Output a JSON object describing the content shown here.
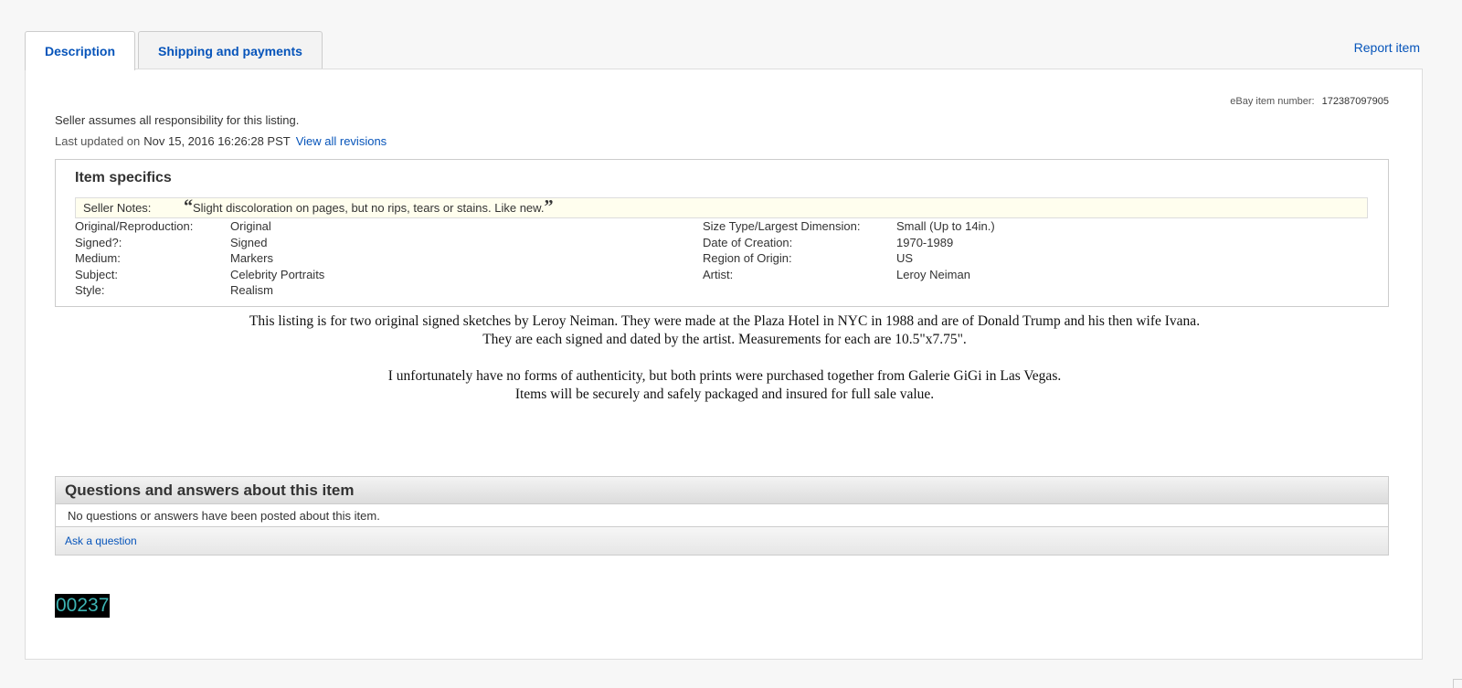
{
  "tabs": [
    {
      "label": "Description",
      "active": true
    },
    {
      "label": "Shipping and payments",
      "active": false
    }
  ],
  "report_item": "Report item",
  "item_number": {
    "label": "eBay item number:",
    "value": "172387097905"
  },
  "responsibility": "Seller assumes all responsibility for this listing.",
  "last_updated": {
    "label": "Last updated on",
    "date": "Nov 15, 2016 16:26:28 PST",
    "revisions_link": "View all revisions"
  },
  "item_specifics": {
    "title": "Item specifics",
    "seller_notes_label": "Seller Notes:",
    "seller_notes": "Slight discoloration on pages, but no rips, tears or stains. Like new.",
    "left": [
      {
        "key": "Original/Reproduction:",
        "value": "Original"
      },
      {
        "key": "Signed?:",
        "value": "Signed"
      },
      {
        "key": "Medium:",
        "value": "Markers"
      },
      {
        "key": "Subject:",
        "value": "Celebrity Portraits"
      },
      {
        "key": "Style:",
        "value": "Realism"
      }
    ],
    "right": [
      {
        "key": "Size Type/Largest Dimension:",
        "value": "Small (Up to 14in.)"
      },
      {
        "key": "Date of Creation:",
        "value": "1970-1989"
      },
      {
        "key": "Region of Origin:",
        "value": "US"
      },
      {
        "key": "Artist:",
        "value": "Leroy Neiman"
      }
    ]
  },
  "description": {
    "line1": "This listing is for two original signed sketches by Leroy Neiman. They were made at the Plaza Hotel in NYC in 1988 and are of Donald Trump and his then wife Ivana.",
    "line2": "They are each signed and dated by the artist. Measurements for each are 10.5\"x7.75\".",
    "line3": "I unfortunately have no forms of authenticity, but both prints were purchased together from Galerie GiGi in Las Vegas.",
    "line4": "Items will be securely and safely packaged and insured for full sale value."
  },
  "qa": {
    "title": "Questions and answers about this item",
    "empty_text": "No questions or answers have been posted about this item.",
    "ask_link": "Ask a question"
  },
  "counter": "00237",
  "colors": {
    "link": "#0654ba",
    "counter_text": "#3cb4b4",
    "notes_bg": "#fffeee"
  }
}
